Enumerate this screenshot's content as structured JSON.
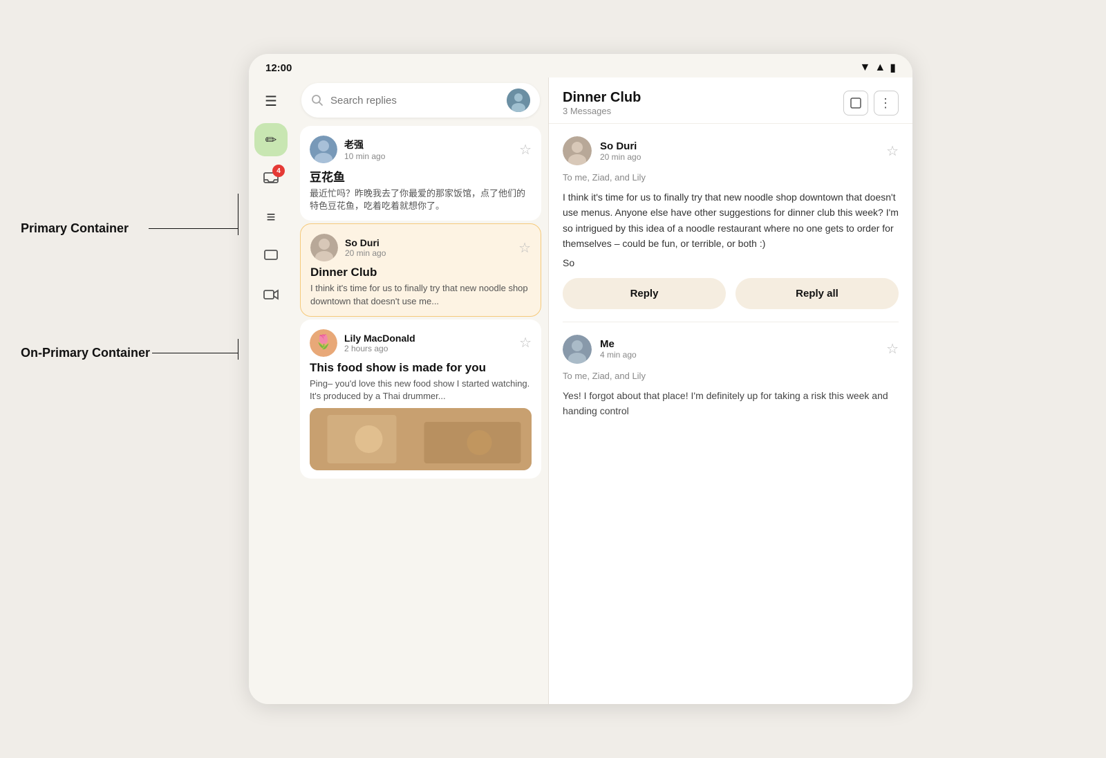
{
  "status": {
    "time": "12:00",
    "icons": [
      "wifi",
      "signal",
      "battery"
    ]
  },
  "annotations": {
    "primary_label": "Primary Container",
    "onprimary_label": "On-Primary Container"
  },
  "search": {
    "placeholder": "Search replies"
  },
  "sidebar": {
    "icons": [
      {
        "name": "menu-icon",
        "symbol": "☰",
        "label": "Menu"
      },
      {
        "name": "compose-icon",
        "symbol": "✏",
        "label": "Compose",
        "style": "compose"
      },
      {
        "name": "inbox-icon",
        "symbol": "📬",
        "label": "Inbox",
        "badge": "4"
      },
      {
        "name": "list-icon",
        "symbol": "≡",
        "label": "List"
      },
      {
        "name": "chat-icon",
        "symbol": "□",
        "label": "Chat"
      },
      {
        "name": "video-icon",
        "symbol": "🎬",
        "label": "Video"
      }
    ]
  },
  "email_list": [
    {
      "id": "email-1",
      "sender": "老强",
      "time": "10 min ago",
      "subject": "豆花鱼",
      "preview": "最近忙吗？昨晚我去了你最爱的那家饭馆，点了他们的特色豆花鱼，吃着吃着就想你了。",
      "selected": false,
      "avatar_color": "#7899b8"
    },
    {
      "id": "email-2",
      "sender": "So Duri",
      "time": "20 min ago",
      "subject": "Dinner Club",
      "preview": "I think it's time for us to finally try that new noodle shop downtown that doesn't use me...",
      "selected": true,
      "avatar_color": "#b8a898"
    },
    {
      "id": "email-3",
      "sender": "Lily MacDonald",
      "time": "2 hours ago",
      "subject": "This food show is made for you",
      "preview": "Ping– you'd love this new food show I started watching. It's produced by a Thai drummer...",
      "selected": false,
      "avatar_color": "#e8a878",
      "has_image": true
    }
  ],
  "detail": {
    "title": "Dinner Club",
    "message_count": "3 Messages",
    "messages": [
      {
        "id": "msg-1",
        "sender": "So Duri",
        "time": "20 min ago",
        "to": "To me, Ziad, and Lily",
        "body": "I think it's time for us to finally try that new noodle shop downtown that doesn't use menus. Anyone else have other suggestions for dinner club this week? I'm so intrigued by this idea of a noodle restaurant where no one gets to order for themselves – could be fun, or terrible, or both :)",
        "signature": "So",
        "avatar_color": "#b8a898"
      },
      {
        "id": "msg-2",
        "sender": "Me",
        "time": "4 min ago",
        "to": "To me, Ziad, and Lily",
        "body": "Yes! I forgot about that place! I'm definitely up for taking a risk this week and handing control",
        "avatar_color": "#8899aa"
      }
    ],
    "reply_button": "Reply",
    "reply_all_button": "Reply all"
  }
}
